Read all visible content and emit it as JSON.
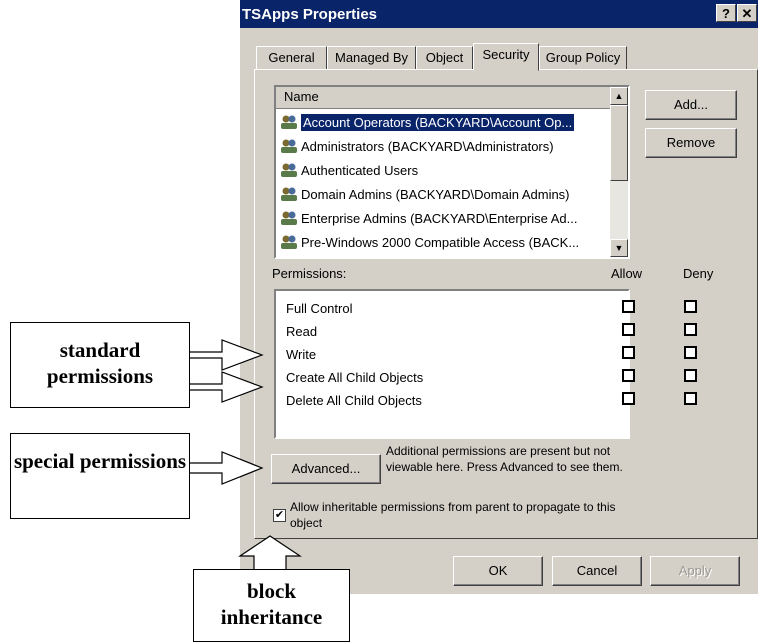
{
  "dialog": {
    "title": "TSApps Properties",
    "help_btn": "?",
    "close_btn": "✕",
    "tabs": [
      "General",
      "Managed By",
      "Object",
      "Security",
      "Group Policy"
    ],
    "active_tab": "Security",
    "list": {
      "header": "Name",
      "items": [
        "Account Operators (BACKYARD\\Account Op...",
        "Administrators (BACKYARD\\Administrators)",
        "Authenticated Users",
        "Domain Admins (BACKYARD\\Domain Admins)",
        "Enterprise Admins (BACKYARD\\Enterprise Ad...",
        "Pre-Windows 2000 Compatible Access (BACK..."
      ],
      "selected_index": 0
    },
    "add_label": "Add...",
    "remove_label": "Remove",
    "permissions_label": "Permissions:",
    "allow_label": "Allow",
    "deny_label": "Deny",
    "permissions": [
      {
        "name": "Full Control",
        "allow": false,
        "deny": false
      },
      {
        "name": "Read",
        "allow": false,
        "deny": false
      },
      {
        "name": "Write",
        "allow": false,
        "deny": false
      },
      {
        "name": "Create All Child Objects",
        "allow": false,
        "deny": false
      },
      {
        "name": "Delete All Child Objects",
        "allow": false,
        "deny": false
      }
    ],
    "advanced_label": "Advanced...",
    "advanced_note": "Additional permissions are present but not viewable here. Press Advanced to see them.",
    "inherit_label": "Allow inheritable permissions from parent to propagate to this object",
    "inherit_checked": true,
    "ok_label": "OK",
    "cancel_label": "Cancel",
    "apply_label": "Apply"
  },
  "callouts": {
    "standard": "standard permissions",
    "special": "special permissions",
    "block": "block inheritance"
  },
  "colors": {
    "titlebar": "#0a246a",
    "dialog_bg": "#d4d0c8",
    "selection": "#0a246a"
  }
}
